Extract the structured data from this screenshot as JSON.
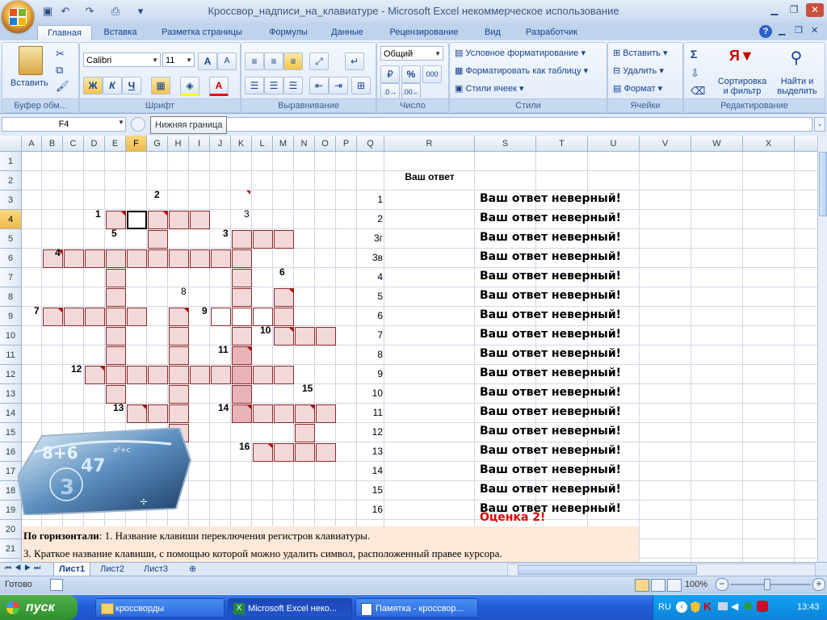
{
  "window": {
    "title": "Кроссвор_надписи_на_клавиатуре - Microsoft Excel некоммерческое использование"
  },
  "ribbon_tabs": [
    "Главная",
    "Вставка",
    "Разметка страницы",
    "Формулы",
    "Данные",
    "Рецензирование",
    "Вид",
    "Разработчик"
  ],
  "ribbon": {
    "clipboard": {
      "label": "Буфер обм...",
      "paste": "Вставить"
    },
    "font": {
      "label": "Шрифт",
      "name": "Calibri",
      "size": "11",
      "bold": "Ж",
      "italic": "К",
      "underline": "Ч",
      "grow": "A",
      "shrink": "A"
    },
    "alignment": {
      "label": "Выравнивание"
    },
    "number": {
      "label": "Число",
      "format": "Общий",
      "percent": "%",
      "thousands": "000"
    },
    "styles": {
      "label": "Стили",
      "conditional": "Условное форматирование",
      "table": "Форматировать как таблицу",
      "cell_styles": "Стили ячеек"
    },
    "cells": {
      "label": "Ячейки",
      "insert": "Вставить",
      "delete": "Удалить",
      "format": "Формат"
    },
    "editing": {
      "label": "Редактирование",
      "sigma": "Σ",
      "sort1": "Сортировка",
      "sort2": "и фильтр",
      "find1": "Найти и",
      "find2": "выделить"
    }
  },
  "formula_bar": {
    "name_box": "F4",
    "tooltip": "Нижняя граница"
  },
  "columns": [
    "A",
    "B",
    "C",
    "D",
    "E",
    "F",
    "G",
    "H",
    "I",
    "J",
    "K",
    "L",
    "M",
    "N",
    "O",
    "P",
    "Q",
    "R",
    "S",
    "T",
    "U",
    "V",
    "W",
    "X",
    "Y"
  ],
  "rows": [
    "1",
    "2",
    "3",
    "4",
    "5",
    "6",
    "7",
    "8",
    "9",
    "10",
    "11",
    "12",
    "13",
    "14",
    "15",
    "16",
    "17",
    "18",
    "19",
    "20",
    "21",
    "22"
  ],
  "selected_cell": "F4",
  "clue_numbers": [
    "1",
    "2",
    "3",
    "3",
    "4",
    "5",
    "6",
    "7",
    "8",
    "9",
    "10",
    "11",
    "12",
    "13",
    "14",
    "15",
    "16"
  ],
  "answer_header": "Ваш ответ",
  "question_labels": [
    "1",
    "2",
    "3г",
    "3в",
    "4",
    "5",
    "6",
    "7",
    "8",
    "9",
    "10",
    "11",
    "12",
    "13",
    "14",
    "15",
    "16"
  ],
  "answers": [
    "Ваш ответ неверный!",
    "Ваш ответ неверный!",
    "Ваш ответ неверный!",
    "Ваш ответ неверный!",
    "Ваш ответ неверный!",
    "Ваш ответ неверный!",
    "Ваш ответ неверный!",
    "Ваш ответ неверный!",
    "Ваш ответ неверный!",
    "Ваш ответ неверный!",
    "Ваш ответ неверный!",
    "Ваш ответ неверный!",
    "Ваш ответ неверный!",
    "Ваш ответ неверный!",
    "Ваш ответ неверный!",
    "Ваш ответ неверный!",
    "Ваш ответ неверный!"
  ],
  "grade": "Оценка 2!",
  "notes": {
    "line1_bold": "По горизонтали",
    "line1_rest": ": 1. Название клавиши переключения регистров клавиатуры.",
    "line2": "3. Краткое название клавиши, с помощью которой можно удалить символ, расположенный правее курсора."
  },
  "sheet_tabs": [
    "Лист1",
    "Лист2",
    "Лист3"
  ],
  "status": {
    "ready": "Готово",
    "zoom": "100%"
  },
  "taskbar": {
    "start": "пуск",
    "tasks": [
      "кроссворды",
      "Microsoft Excel неко...",
      "Памятка - кроссвор..."
    ],
    "lang": "RU",
    "clock": "13:43"
  },
  "colors": {
    "grade": "#e00000",
    "cell_fill": "#f2d8d8",
    "cell_border": "#8a2a2a",
    "selection": "#f2b949"
  }
}
